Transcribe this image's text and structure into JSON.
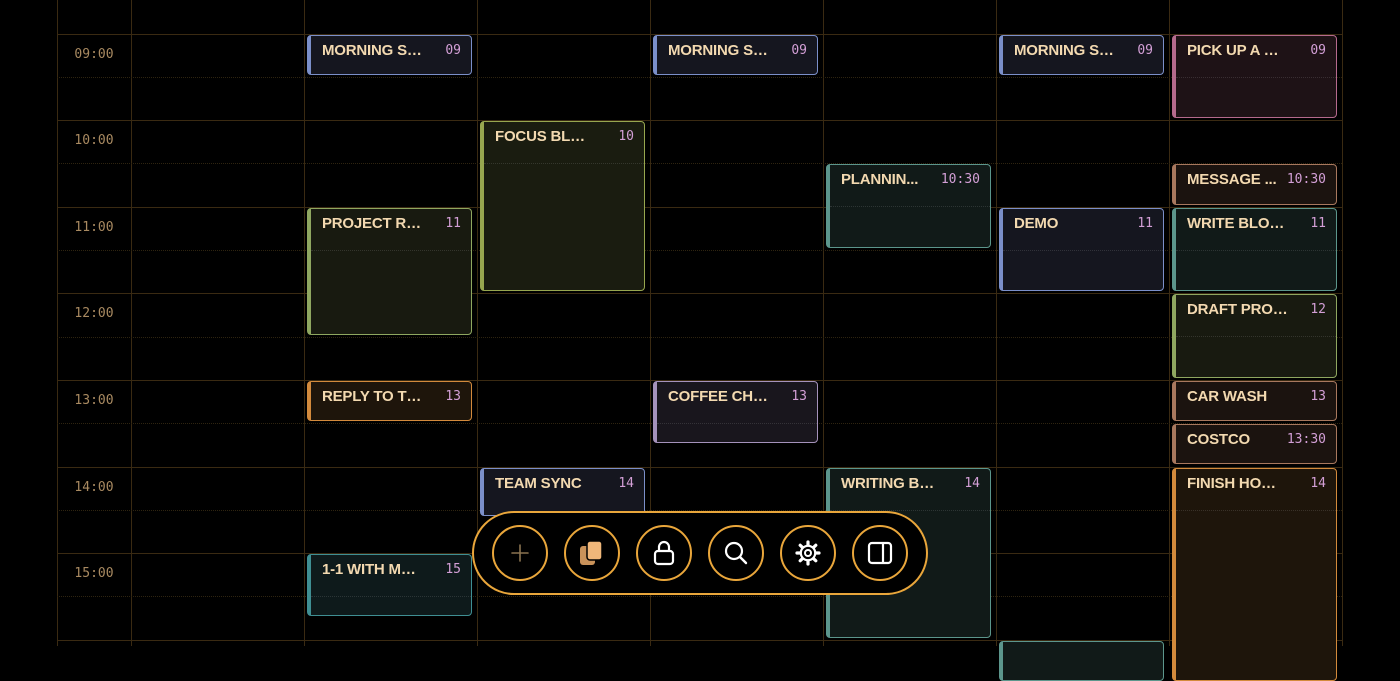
{
  "time_labels": [
    "09:00",
    "10:00",
    "11:00",
    "12:00",
    "13:00",
    "14:00",
    "15:00"
  ],
  "events": [
    {
      "title": "MORNING STA...",
      "time": "09",
      "color": "#7b8fc9",
      "fill": "#15161f",
      "day": 0,
      "start": 9,
      "end": 9.5
    },
    {
      "title": "PROJECT REVIEW",
      "time": "11",
      "color": "#8fa760",
      "fill": "#181a10",
      "day": 0,
      "start": 11,
      "end": 12.5
    },
    {
      "title": "REPLY TO THAT...",
      "time": "13",
      "color": "#d38a3c",
      "fill": "#1e150b",
      "day": 0,
      "start": 13,
      "end": 13.5
    },
    {
      "title": "1-1 WITH MAN...",
      "time": "15",
      "color": "#3f8f93",
      "fill": "#0e1a1b",
      "day": 0,
      "start": 15,
      "end": 15.75
    },
    {
      "title": "FOCUS BLOCK",
      "time": "10",
      "color": "#97a64f",
      "fill": "#1a1c10",
      "day": 1,
      "start": 10,
      "end": 12
    },
    {
      "title": "TEAM SYNC",
      "time": "14",
      "color": "#7b8fc9",
      "fill": "#15161f",
      "day": 1,
      "start": 14,
      "end": 14.6
    },
    {
      "title": "MORNING STA...",
      "time": "09",
      "color": "#7b8fc9",
      "fill": "#15161f",
      "day": 2,
      "start": 9,
      "end": 9.5
    },
    {
      "title": "COFFEE CHAT",
      "time": "13",
      "color": "#a592bb",
      "fill": "#19161d",
      "day": 2,
      "start": 13,
      "end": 13.75
    },
    {
      "title": "PLANNIN...",
      "time": "10:30",
      "color": "#5c968c",
      "fill": "#111a18",
      "day": 3,
      "start": 10.5,
      "end": 11.5
    },
    {
      "title": "WRITING BLOCK",
      "time": "14",
      "color": "#5c968c",
      "fill": "#111a18",
      "day": 3,
      "start": 14,
      "end": 16
    },
    {
      "title": "MORNING STA...",
      "time": "09",
      "color": "#7b8fc9",
      "fill": "#15161f",
      "day": 4,
      "start": 9,
      "end": 9.5
    },
    {
      "title": "DEMO",
      "time": "11",
      "color": "#7b8fc9",
      "fill": "#15161f",
      "day": 4,
      "start": 11,
      "end": 12
    },
    {
      "title": "",
      "time": "",
      "color": "#5c968c",
      "fill": "#111a18",
      "day": 4,
      "start": 16,
      "end": 16.5
    },
    {
      "title": "PICK UP A GIFT",
      "time": "09",
      "color": "#b56a8d",
      "fill": "#1e1216",
      "day": 5,
      "start": 9,
      "end": 10
    },
    {
      "title": "MESSAGE ...",
      "time": "10:30",
      "color": "#a8785e",
      "fill": "#1b130f",
      "day": 5,
      "start": 10.5,
      "end": 11
    },
    {
      "title": "WRITE BLOG P...",
      "time": "11",
      "color": "#5c968c",
      "fill": "#111a18",
      "day": 5,
      "start": 11,
      "end": 12
    },
    {
      "title": "DRAFT PROJEC...",
      "time": "12",
      "color": "#8fa760",
      "fill": "#181a10",
      "day": 5,
      "start": 12,
      "end": 13
    },
    {
      "title": "CAR WASH",
      "time": "13",
      "color": "#a8785e",
      "fill": "#1b130f",
      "day": 5,
      "start": 13,
      "end": 13.5
    },
    {
      "title": "COSTCO",
      "time": "13:30",
      "color": "#a8785e",
      "fill": "#1b130f",
      "day": 5,
      "start": 13.5,
      "end": 14
    },
    {
      "title": "FINISH HOME ...",
      "time": "14",
      "color": "#d38a3c",
      "fill": "#1e150b",
      "day": 5,
      "start": 14,
      "end": 16.5
    }
  ],
  "toolbar": {
    "accent": "#e9a63b",
    "buttons": [
      {
        "name": "add-button",
        "icon": "plus-icon"
      },
      {
        "name": "copy-button",
        "icon": "copy-icon"
      },
      {
        "name": "lock-button",
        "icon": "lock-icon"
      },
      {
        "name": "search-button",
        "icon": "search-icon"
      },
      {
        "name": "settings-button",
        "icon": "gear-icon"
      },
      {
        "name": "sidebar-toggle-button",
        "icon": "sidebar-icon"
      }
    ]
  }
}
